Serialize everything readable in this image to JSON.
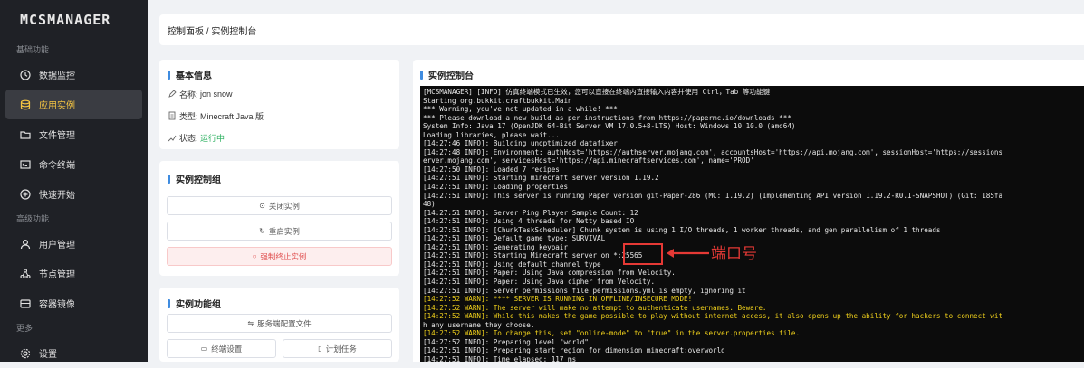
{
  "app": {
    "logo": "MCSMANAGER"
  },
  "sidebar": {
    "section_basic": "基础功能",
    "section_advanced": "高级功能",
    "section_more": "更多",
    "items": [
      {
        "label": "数据监控",
        "icon": "clock-icon"
      },
      {
        "label": "应用实例",
        "icon": "database-icon"
      },
      {
        "label": "文件管理",
        "icon": "folder-icon"
      },
      {
        "label": "命令终端",
        "icon": "terminal-icon"
      },
      {
        "label": "快速开始",
        "icon": "plus-circle-icon"
      },
      {
        "label": "用户管理",
        "icon": "user-icon"
      },
      {
        "label": "节点管理",
        "icon": "cluster-icon"
      },
      {
        "label": "容器镜像",
        "icon": "container-icon"
      },
      {
        "label": "设置",
        "icon": "gear-icon"
      }
    ],
    "active_index": 1
  },
  "breadcrumb": "控制面板 / 实例控制台",
  "basic_info": {
    "title": "基本信息",
    "name_label": "名称:",
    "name_value": "jon snow",
    "type_label": "类型:",
    "type_value": "Minecraft Java 版",
    "status_label": "状态:",
    "status_value": "运行中",
    "status_color": "#2bb05f"
  },
  "control_group": {
    "title": "实例控制组",
    "stop": "关闭实例",
    "restart": "重启实例",
    "kill": "强制终止实例"
  },
  "function_group": {
    "title": "实例功能组",
    "config": "服务端配置文件",
    "terminal_settings": "终端设置",
    "schedule": "计划任务"
  },
  "console": {
    "title": "实例控制台",
    "lines": [
      {
        "text": "[MCSMANAGER] [INFO] 仿真终端模式已生效，您可以直接在终端内直接输入内容并使用 Ctrl，Tab 等功能键",
        "warn": false
      },
      {
        "text": "Starting org.bukkit.craftbukkit.Main",
        "warn": false
      },
      {
        "text": "*** Warning, you've not updated in a while! ***",
        "warn": false
      },
      {
        "text": "*** Please download a new build as per instructions from https://papermc.io/downloads ***",
        "warn": false
      },
      {
        "text": "System Info: Java 17 (OpenJDK 64-Bit Server VM 17.0.5+8-LTS) Host: Windows 10 10.0 (amd64)",
        "warn": false
      },
      {
        "text": "Loading libraries, please wait...",
        "warn": false
      },
      {
        "text": "[14:27:46 INFO]: Building unoptimized datafixer",
        "warn": false
      },
      {
        "text": "[14:27:48 INFO]: Environment: authHost='https://authserver.mojang.com', accountsHost='https://api.mojang.com', sessionHost='https://sessions",
        "warn": false
      },
      {
        "text": "erver.mojang.com', servicesHost='https://api.minecraftservices.com', name='PROD'",
        "warn": false
      },
      {
        "text": "[14:27:50 INFO]: Loaded 7 recipes",
        "warn": false
      },
      {
        "text": "[14:27:51 INFO]: Starting minecraft server version 1.19.2",
        "warn": false
      },
      {
        "text": "[14:27:51 INFO]: Loading properties",
        "warn": false
      },
      {
        "text": "[14:27:51 INFO]: This server is running Paper version git-Paper-286 (MC: 1.19.2) (Implementing API version 1.19.2-R0.1-SNAPSHOT) (Git: 185fa",
        "warn": false
      },
      {
        "text": "48)",
        "warn": false
      },
      {
        "text": "[14:27:51 INFO]: Server Ping Player Sample Count: 12",
        "warn": false
      },
      {
        "text": "[14:27:51 INFO]: Using 4 threads for Netty based IO",
        "warn": false
      },
      {
        "text": "[14:27:51 INFO]: [ChunkTaskScheduler] Chunk system is using 1 I/O threads, 1 worker threads, and gen parallelism of 1 threads",
        "warn": false
      },
      {
        "text": "[14:27:51 INFO]: Default game type: SURVIVAL",
        "warn": false
      },
      {
        "text": "[14:27:51 INFO]: Generating keypair",
        "warn": false
      },
      {
        "text": "[14:27:51 INFO]: Starting Minecraft server on *:25565",
        "warn": false
      },
      {
        "text": "[14:27:51 INFO]: Using default channel type",
        "warn": false
      },
      {
        "text": "[14:27:51 INFO]: Paper: Using Java compression from Velocity.",
        "warn": false
      },
      {
        "text": "[14:27:51 INFO]: Paper: Using Java cipher from Velocity.",
        "warn": false
      },
      {
        "text": "[14:27:51 INFO]: Server permissions file permissions.yml is empty, ignoring it",
        "warn": false
      },
      {
        "text": "[14:27:52 WARN]: **** SERVER IS RUNNING IN OFFLINE/INSECURE MODE!",
        "warn": true
      },
      {
        "text": "[14:27:52 WARN]: The server will make no attempt to authenticate usernames. Beware.",
        "warn": true
      },
      {
        "text": "[14:27:52 WARN]: While this makes the game possible to play without internet access, it also opens up the ability for hackers to connect wit",
        "warn": true
      },
      {
        "text": "h any username they choose.",
        "warn": false
      },
      {
        "text": "[14:27:52 WARN]: To change this, set \"online-mode\" to \"true\" in the server.properties file.",
        "warn": true
      },
      {
        "text": "[14:27:52 INFO]: Preparing level \"world\"",
        "warn": false
      },
      {
        "text": "[14:27:51 INFO]: Preparing start region for dimension minecraft:overworld",
        "warn": false
      },
      {
        "text": "[14:27:51 INFO]: Time elapsed: 117 ms",
        "warn": false
      }
    ]
  },
  "annotation": {
    "label": "端口号",
    "color": "#e53935"
  }
}
